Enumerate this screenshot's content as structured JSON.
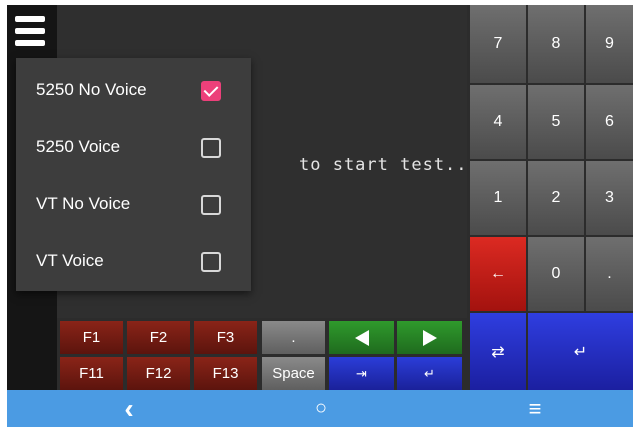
{
  "terminal": {
    "prompt_text": "to start test..."
  },
  "menu": {
    "items": [
      {
        "label": "5250 No Voice",
        "checked": true
      },
      {
        "label": "5250 Voice",
        "checked": false
      },
      {
        "label": "VT No Voice",
        "checked": false
      },
      {
        "label": "VT Voice",
        "checked": false
      }
    ]
  },
  "numpad": {
    "row1": [
      "7",
      "8",
      "9"
    ],
    "row2": [
      "4",
      "5",
      "6"
    ],
    "row3": [
      "1",
      "2",
      "3"
    ],
    "row4": [
      "←",
      "0",
      "."
    ],
    "tab_key": "⇄",
    "enter_key": "↵"
  },
  "function_keys": {
    "row1": [
      "F1",
      "F2",
      "F3"
    ],
    "row2": [
      "F11",
      "F12",
      "F13"
    ]
  },
  "special_keys": {
    "dot": ".",
    "space": "Space",
    "tab": "⇥",
    "enter": "↵"
  },
  "navbar": {
    "back": "‹",
    "home": "○",
    "menu": "≡"
  },
  "colors": {
    "checkbox_checked": "#ec407a",
    "navbar": "#4b9be3",
    "backspace_key": "#c81c16",
    "blue_key": "#2430c8",
    "green_key": "#2a8a28",
    "function_key": "#7a1e14"
  }
}
